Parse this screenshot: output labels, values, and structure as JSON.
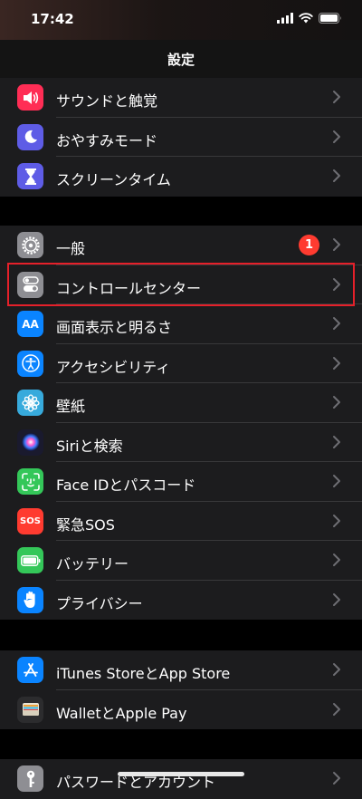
{
  "status_bar": {
    "time": "17:42",
    "icons": [
      "cellular-signal-icon",
      "wifi-icon",
      "battery-icon"
    ]
  },
  "nav": {
    "title": "設定"
  },
  "groups": [
    {
      "items": [
        {
          "label": "サウンドと触覚",
          "icon": "speaker-icon",
          "color": "#ff2d55"
        },
        {
          "label": "おやすみモード",
          "icon": "moon-icon",
          "color": "#5e5ce6"
        },
        {
          "label": "スクリーンタイム",
          "icon": "hourglass-icon",
          "color": "#5e5ce6"
        }
      ]
    },
    {
      "items": [
        {
          "label": "一般",
          "icon": "gear-icon",
          "color": "#8e8e93",
          "badge": "1"
        },
        {
          "label": "コントロールセンター",
          "icon": "toggles-icon",
          "color": "#8e8e93",
          "highlighted": true
        },
        {
          "label": "画面表示と明るさ",
          "icon": "text-size-icon",
          "color": "#0a84ff",
          "icon_text": "AA"
        },
        {
          "label": "アクセシビリティ",
          "icon": "accessibility-icon",
          "color": "#0a84ff"
        },
        {
          "label": "壁紙",
          "icon": "flower-icon",
          "color": "#37aadc"
        },
        {
          "label": "Siriと検索",
          "icon": "siri-icon",
          "color": "#1a1a2e"
        },
        {
          "label": "Face IDとパスコード",
          "icon": "face-id-icon",
          "color": "#34c759"
        },
        {
          "label": "緊急SOS",
          "icon": "sos-icon",
          "color": "#ff3b30",
          "icon_text": "SOS"
        },
        {
          "label": "バッテリー",
          "icon": "battery-icon",
          "color": "#34c759"
        },
        {
          "label": "プライバシー",
          "icon": "hand-icon",
          "color": "#0a84ff"
        }
      ]
    },
    {
      "items": [
        {
          "label": "iTunes StoreとApp Store",
          "icon": "app-store-icon",
          "color": "#0a84ff"
        },
        {
          "label": "WalletとApple Pay",
          "icon": "wallet-icon",
          "color": "#2c2c2e"
        }
      ]
    },
    {
      "items": [
        {
          "label": "パスワードとアカウント",
          "icon": "key-icon",
          "color": "#8e8e93"
        }
      ]
    }
  ],
  "colors": {
    "background": "#000000",
    "cell": "#1c1c1e",
    "separator": "#38383a",
    "chevron": "#6e6e73",
    "badge": "#ff3b30",
    "highlight_border": "#e5202a"
  }
}
